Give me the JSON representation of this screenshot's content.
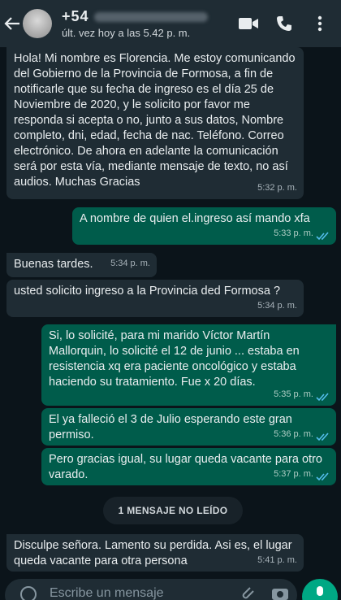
{
  "header": {
    "contact_name": "+54",
    "status": "últ. vez hoy a las 5.42 p. m."
  },
  "messages": [
    {
      "dir": "in",
      "text": "Hola! Mi nombre es Florencia. Me estoy comunicando del Gobierno de la Provincia de Formosa, a fin de notificarle que su fecha de ingreso es el día 25 de Noviembre de 2020, y le solicito por favor me responda si acepta o no, junto a sus datos, Nombre completo, dni, edad, fecha de nac. Teléfono. Correo electrónico. De ahora en adelante la comunicación será por esta vía, mediante mensaje de texto, no así audios. Muchas Gracias",
      "time": "5:32 p. m."
    },
    {
      "dir": "out",
      "text": "A nombre de quien  el.ingreso así mando xfa",
      "time": "5:33 p. m."
    },
    {
      "dir": "in",
      "text": "Buenas tardes.",
      "time": "5:34 p. m."
    },
    {
      "dir": "in",
      "text": "usted solicito ingreso a la Provincia ded Formosa ?",
      "time": "5:34 p. m."
    },
    {
      "dir": "out",
      "text": "Si, lo solicité, para mi marido Víctor Martín Mallorquin,  lo solicité el 12 de junio ... estaba en resistencia xq era paciente oncológico y estaba haciendo su tratamiento. Fue x 20 días.",
      "time": "5:35 p. m."
    },
    {
      "dir": "out",
      "text": "El ya falleció el 3 de Julio esperando este gran permiso.",
      "time": "5:36 p. m."
    },
    {
      "dir": "out",
      "text": "Pero gracias igual, su lugar queda vacante para otro varado.",
      "time": "5:37 p. m."
    },
    {
      "dir": "in",
      "text": "Disculpe señora. Lamento su perdida. Asi es, el lugar queda vacante para otra persona",
      "time": "5:41 p. m."
    }
  ],
  "unread_label": "1 MENSAJE NO LEÍDO",
  "composer": {
    "placeholder": "Escribe un mensaje"
  },
  "colors": {
    "incoming": "#1f2c34",
    "outgoing": "#005c4b",
    "read_ticks": "#53bdeb"
  }
}
